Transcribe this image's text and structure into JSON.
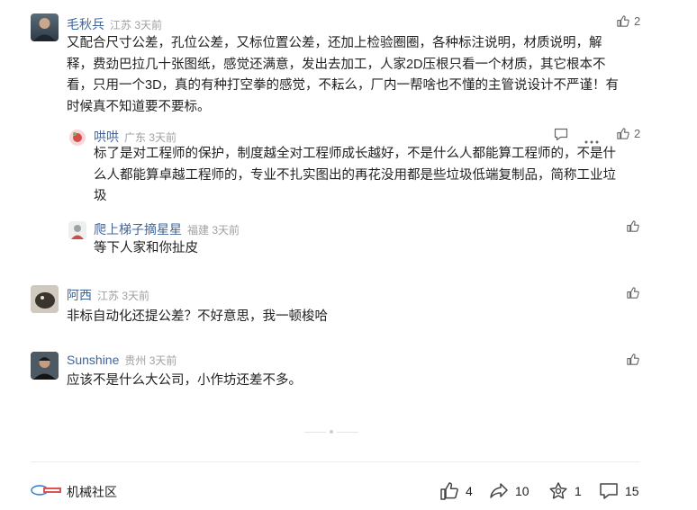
{
  "comments": [
    {
      "name": "毛秋兵",
      "location": "江苏",
      "time": "3天前",
      "likes": "2",
      "text_lines": [
        "又配合尺寸公差，孔位公差，又标位置公差，还加上检验圈圈，各种标注说明，材质说明，解",
        "释，费劲巴拉几十张图纸，感觉还满意，发出去加工，人家2D压根只看一个材质，其它根本不",
        "看，只用一个3D，真的有种打空拳的感觉，不耘么，厂内一帮啥也不懂的主管说设计不严谨！有",
        "时候真不知道要不要标。"
      ]
    }
  ],
  "replies": [
    {
      "name": "哄哄",
      "location": "广东",
      "time": "3天前",
      "likes": "2",
      "text_lines": [
        "标了是对工程师的保护，制度越全对工程师成长越好，不是什么人都能算工程师的，不是什",
        "么人都能算卓越工程师的，专业不扎实图出的再花没用都是些垃圾低端复制品，简称工业垃",
        "圾"
      ]
    },
    {
      "name": "爬上梯子摘星星",
      "location": "福建",
      "time": "3天前",
      "likes": "",
      "text": "等下人家和你扯皮"
    }
  ],
  "more_comments": [
    {
      "name": "阿西",
      "location": "江苏",
      "time": "3天前",
      "likes": "",
      "text": "非标自动化还提公差？不好意思，我一顿梭哈"
    },
    {
      "name": "Sunshine",
      "location": "贵州",
      "time": "3天前",
      "likes": "",
      "text": "应该不是什么大公司，小作坊还差不多。"
    }
  ],
  "footer": {
    "source_name": "机械社区",
    "like_count": "4",
    "share_count": "10",
    "favorite_count": "1",
    "comment_count": "15"
  },
  "colors": {
    "name": "#406599",
    "meta": "#a0a0a0",
    "text": "#222222",
    "icon": "#666666"
  },
  "icons": [
    "thumbs-up-icon",
    "comment-icon",
    "more-icon",
    "share-icon",
    "star-icon",
    "comment-bubble-icon"
  ]
}
